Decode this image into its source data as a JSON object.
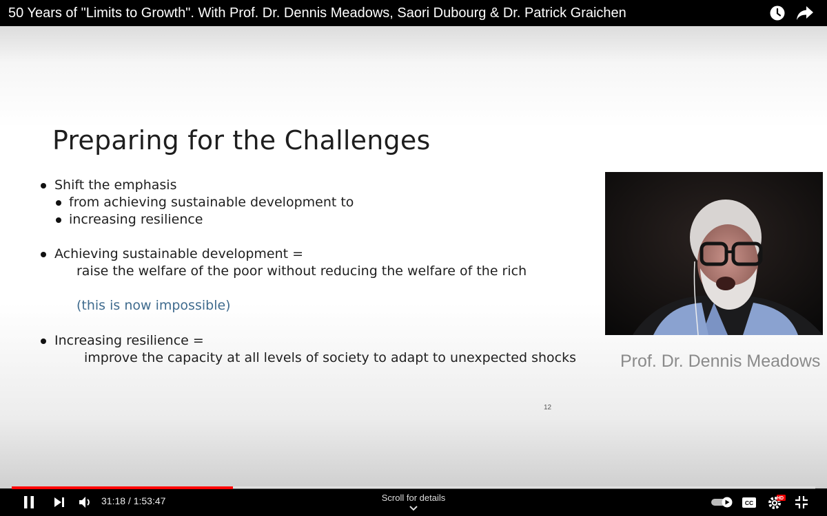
{
  "video": {
    "title": "50 Years of \"Limits to Growth\". With Prof. Dr. Dennis Meadows, Saori Dubourg & Dr. Patrick Graichen"
  },
  "slide": {
    "title": "Preparing for the Challenges",
    "bullets": [
      "Shift the emphasis",
      "from achieving sustainable development to",
      "increasing resilience",
      "Achieving sustainable development =",
      "raise the welfare of the poor without reducing the welfare of the rich",
      "(this is now impossible)",
      "Increasing resilience =",
      "improve the capacity at all levels of society to adapt to unexpected shocks"
    ],
    "page_number": "12"
  },
  "webcam": {
    "speaker_name": "Prof. Dr. Dennis Meadows"
  },
  "player": {
    "time": "31:18 / 1:53:47",
    "progress_fraction": 0.2751,
    "scroll_hint": "Scroll for details",
    "accent_color": "#ff0000",
    "icons": [
      "watch-later-icon",
      "share-icon",
      "pause-icon",
      "next-icon",
      "volume-icon",
      "autoplay-toggle",
      "captions-icon",
      "settings-icon",
      "exit-fullscreen-icon",
      "chevron-down-icon"
    ],
    "settings_badge": "HD"
  }
}
